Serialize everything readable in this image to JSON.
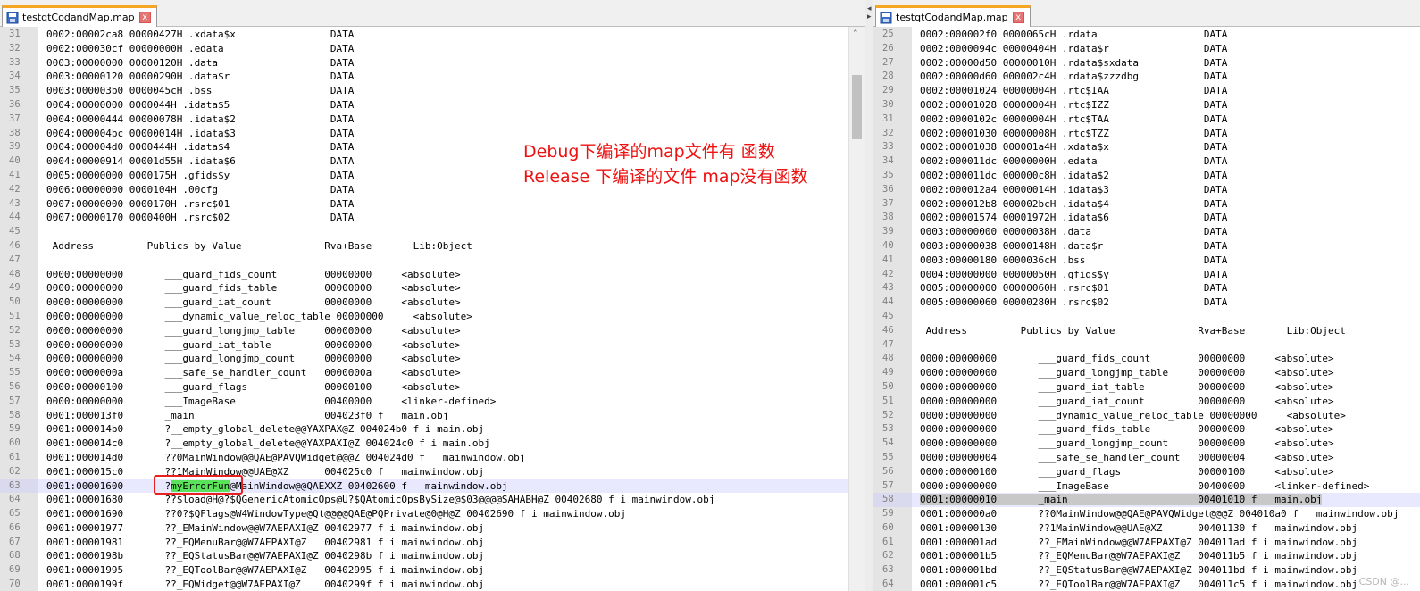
{
  "left_tab": {
    "title": "testqtCodandMap.map",
    "close_label": "x"
  },
  "right_tab": {
    "title": "testqtCodandMap.map"
  },
  "annotation": {
    "line1": "Debug下编译的map文件有 函数",
    "line2": "Release 下编译的文件 map没有函数"
  },
  "watermark": "CSDN @...",
  "colors": {
    "tab_accent": "#f6a623",
    "annotation_red": "#ee1111",
    "highlight_green": "#5ae35a"
  },
  "left_lines": [
    {
      "n": "31",
      "t": "0002:00002ca8 00000427H .xdata$x                DATA"
    },
    {
      "n": "32",
      "t": "0002:000030cf 00000000H .edata                  DATA"
    },
    {
      "n": "33",
      "t": "0003:00000000 00000120H .data                   DATA"
    },
    {
      "n": "34",
      "t": "0003:00000120 00000290H .data$r                 DATA"
    },
    {
      "n": "35",
      "t": "0003:000003b0 0000045cH .bss                    DATA"
    },
    {
      "n": "36",
      "t": "0004:00000000 0000044H .idata$5                 DATA"
    },
    {
      "n": "37",
      "t": "0004:00000444 00000078H .idata$2                DATA"
    },
    {
      "n": "38",
      "t": "0004:000004bc 00000014H .idata$3                DATA"
    },
    {
      "n": "39",
      "t": "0004:000004d0 0000444H .idata$4                 DATA"
    },
    {
      "n": "40",
      "t": "0004:00000914 00001d55H .idata$6                DATA"
    },
    {
      "n": "41",
      "t": "0005:00000000 0000175H .gfids$y                 DATA"
    },
    {
      "n": "42",
      "t": "0006:00000000 0000104H .00cfg                   DATA"
    },
    {
      "n": "43",
      "t": "0007:00000000 0000170H .rsrc$01                 DATA"
    },
    {
      "n": "44",
      "t": "0007:00000170 0000400H .rsrc$02                 DATA"
    },
    {
      "n": "45",
      "t": ""
    },
    {
      "n": "46",
      "t": " Address         Publics by Value              Rva+Base       Lib:Object"
    },
    {
      "n": "47",
      "t": ""
    },
    {
      "n": "48",
      "t": "0000:00000000       ___guard_fids_count        00000000     <absolute>"
    },
    {
      "n": "49",
      "t": "0000:00000000       ___guard_fids_table        00000000     <absolute>"
    },
    {
      "n": "50",
      "t": "0000:00000000       ___guard_iat_count         00000000     <absolute>"
    },
    {
      "n": "51",
      "t": "0000:00000000       ___dynamic_value_reloc_table 00000000     <absolute>"
    },
    {
      "n": "52",
      "t": "0000:00000000       ___guard_longjmp_table     00000000     <absolute>"
    },
    {
      "n": "53",
      "t": "0000:00000000       ___guard_iat_table         00000000     <absolute>"
    },
    {
      "n": "54",
      "t": "0000:00000000       ___guard_longjmp_count     00000000     <absolute>"
    },
    {
      "n": "55",
      "t": "0000:0000000a       ___safe_se_handler_count   0000000a     <absolute>"
    },
    {
      "n": "56",
      "t": "0000:00000100       ___guard_flags             00000100     <absolute>"
    },
    {
      "n": "57",
      "t": "0000:00000000       ___ImageBase               00400000     <linker-defined>"
    },
    {
      "n": "58",
      "t": "0001:000013f0       _main                      004023f0 f   main.obj"
    },
    {
      "n": "59",
      "t": "0001:000014b0       ?__empty_global_delete@@YAXPAX@Z 004024b0 f i main.obj"
    },
    {
      "n": "60",
      "t": "0001:000014c0       ?__empty_global_delete@@YAXPAXI@Z 004024c0 f i main.obj"
    },
    {
      "n": "61",
      "t": "0001:000014d0       ??0MainWindow@@QAE@PAVQWidget@@@Z 004024d0 f   mainwindow.obj"
    },
    {
      "n": "62",
      "t": "0001:000015c0       ??1MainWindow@@UAE@XZ      004025c0 f   mainwindow.obj"
    },
    {
      "n": "63",
      "t": "0001:00001600       ?",
      "hl": "myErrorFun",
      "rest": "@MainWindow@@QAEXXZ 00402600 f   mainwindow.obj",
      "current": true
    },
    {
      "n": "64",
      "t": "0001:00001680       ??$load@H@?$QGenericAtomicOps@U?$QAtomicOpsBySize@$03@@@@SAHABH@Z 00402680 f i mainwindow.obj"
    },
    {
      "n": "65",
      "t": "0001:00001690       ??0?$QFlags@W4WindowType@Qt@@@@QAE@PQPrivate@0@H@Z 00402690 f i mainwindow.obj"
    },
    {
      "n": "66",
      "t": "0001:00001977       ??_EMainWindow@@W7AEPAXI@Z 00402977 f i mainwindow.obj"
    },
    {
      "n": "67",
      "t": "0001:00001981       ??_EQMenuBar@@W7AEPAXI@Z   00402981 f i mainwindow.obj"
    },
    {
      "n": "68",
      "t": "0001:0000198b       ??_EQStatusBar@@W7AEPAXI@Z 0040298b f i mainwindow.obj"
    },
    {
      "n": "69",
      "t": "0001:00001995       ??_EQToolBar@@W7AEPAXI@Z   00402995 f i mainwindow.obj"
    },
    {
      "n": "70",
      "t": "0001:0000199f       ??_EQWidget@@W7AEPAXI@Z    0040299f f i mainwindow.obj"
    }
  ],
  "right_lines": [
    {
      "n": "25",
      "t": "0002:000002f0 0000065cH .rdata                  DATA"
    },
    {
      "n": "26",
      "t": "0002:0000094c 00000404H .rdata$r                DATA"
    },
    {
      "n": "27",
      "t": "0002:00000d50 00000010H .rdata$sxdata           DATA"
    },
    {
      "n": "28",
      "t": "0002:00000d60 000002c4H .rdata$zzzdbg           DATA"
    },
    {
      "n": "29",
      "t": "0002:00001024 00000004H .rtc$IAA                DATA"
    },
    {
      "n": "30",
      "t": "0002:00001028 00000004H .rtc$IZZ                DATA"
    },
    {
      "n": "31",
      "t": "0002:0000102c 00000004H .rtc$TAA                DATA"
    },
    {
      "n": "32",
      "t": "0002:00001030 00000008H .rtc$TZZ                DATA"
    },
    {
      "n": "33",
      "t": "0002:00001038 000001a4H .xdata$x                DATA"
    },
    {
      "n": "34",
      "t": "0002:000011dc 00000000H .edata                  DATA"
    },
    {
      "n": "35",
      "t": "0002:000011dc 000000c8H .idata$2                DATA"
    },
    {
      "n": "36",
      "t": "0002:000012a4 00000014H .idata$3                DATA"
    },
    {
      "n": "37",
      "t": "0002:000012b8 000002bcH .idata$4                DATA"
    },
    {
      "n": "38",
      "t": "0002:00001574 00001972H .idata$6                DATA"
    },
    {
      "n": "39",
      "t": "0003:00000000 00000038H .data                   DATA"
    },
    {
      "n": "40",
      "t": "0003:00000038 00000148H .data$r                 DATA"
    },
    {
      "n": "41",
      "t": "0003:00000180 0000036cH .bss                    DATA"
    },
    {
      "n": "42",
      "t": "0004:00000000 00000050H .gfids$y                DATA"
    },
    {
      "n": "43",
      "t": "0005:00000000 00000060H .rsrc$01                DATA"
    },
    {
      "n": "44",
      "t": "0005:00000060 00000280H .rsrc$02                DATA"
    },
    {
      "n": "45",
      "t": ""
    },
    {
      "n": "46",
      "t": " Address         Publics by Value              Rva+Base       Lib:Object"
    },
    {
      "n": "47",
      "t": ""
    },
    {
      "n": "48",
      "t": "0000:00000000       ___guard_fids_count        00000000     <absolute>"
    },
    {
      "n": "49",
      "t": "0000:00000000       ___guard_longjmp_table     00000000     <absolute>"
    },
    {
      "n": "50",
      "t": "0000:00000000       ___guard_iat_table         00000000     <absolute>"
    },
    {
      "n": "51",
      "t": "0000:00000000       ___guard_iat_count         00000000     <absolute>"
    },
    {
      "n": "52",
      "t": "0000:00000000       ___dynamic_value_reloc_table 00000000     <absolute>"
    },
    {
      "n": "53",
      "t": "0000:00000000       ___guard_fids_table        00000000     <absolute>"
    },
    {
      "n": "54",
      "t": "0000:00000000       ___guard_longjmp_count     00000000     <absolute>"
    },
    {
      "n": "55",
      "t": "0000:00000004       ___safe_se_handler_count   00000004     <absolute>"
    },
    {
      "n": "56",
      "t": "0000:00000100       ___guard_flags             00000100     <absolute>"
    },
    {
      "n": "57",
      "t": "0000:00000000       ___ImageBase               00400000     <linker-defined>"
    },
    {
      "n": "58",
      "t": "",
      "sel": "0001:00000010       _main                      00401010 f   main.obj",
      "current": true
    },
    {
      "n": "59",
      "t": "0001:000000a0       ??0MainWindow@@QAE@PAVQWidget@@@Z 004010a0 f   mainwindow.obj"
    },
    {
      "n": "60",
      "t": "0001:00000130       ??1MainWindow@@UAE@XZ      00401130 f   mainwindow.obj"
    },
    {
      "n": "61",
      "t": "0001:000001ad       ??_EMainWindow@@W7AEPAXI@Z 004011ad f i mainwindow.obj"
    },
    {
      "n": "62",
      "t": "0001:000001b5       ??_EQMenuBar@@W7AEPAXI@Z   004011b5 f i mainwindow.obj"
    },
    {
      "n": "63",
      "t": "0001:000001bd       ??_EQStatusBar@@W7AEPAXI@Z 004011bd f i mainwindow.obj"
    },
    {
      "n": "64",
      "t": "0001:000001c5       ??_EQToolBar@@W7AEPAXI@Z   004011c5 f i mainwindow.obj"
    }
  ]
}
